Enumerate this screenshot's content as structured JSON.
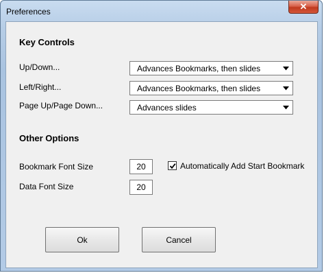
{
  "window": {
    "title": "Preferences",
    "close_icon": "close-icon"
  },
  "key_controls": {
    "title": "Key Controls",
    "rows": [
      {
        "label": "Up/Down...",
        "value": "Advances Bookmarks, then slides"
      },
      {
        "label": "Left/Right...",
        "value": "Advances Bookmarks, then slides"
      },
      {
        "label": "Page Up/Page Down...",
        "value": "Advances slides"
      }
    ]
  },
  "other_options": {
    "title": "Other Options",
    "bookmark_font_size_label": "Bookmark Font Size",
    "bookmark_font_size_value": "20",
    "data_font_size_label": "Data Font Size",
    "data_font_size_value": "20",
    "auto_start_bookmark_label": "Automatically Add Start Bookmark",
    "auto_start_bookmark_checked": true
  },
  "buttons": {
    "ok_label": "Ok",
    "cancel_label": "Cancel"
  }
}
